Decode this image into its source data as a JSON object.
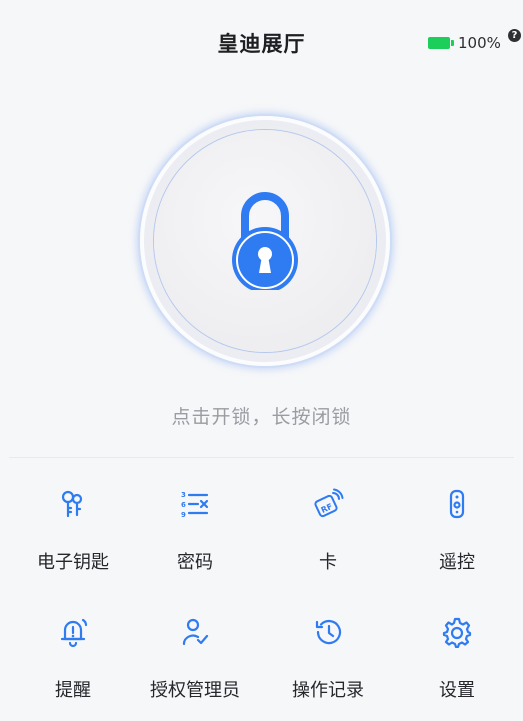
{
  "header": {
    "title": "皇迪展厅",
    "battery_text": "100%",
    "help_glyph": "?"
  },
  "lock": {
    "state_icon": "lock-icon",
    "hint": "点击开锁，长按闭锁"
  },
  "menu": {
    "items": [
      {
        "label": "电子钥匙",
        "icon": "keys-icon"
      },
      {
        "label": "密码",
        "icon": "password-list-icon"
      },
      {
        "label": "卡",
        "icon": "rf-card-icon"
      },
      {
        "label": "遥控",
        "icon": "remote-control-icon"
      },
      {
        "label": "提醒",
        "icon": "bell-icon"
      },
      {
        "label": "授权管理员",
        "icon": "user-check-icon"
      },
      {
        "label": "操作记录",
        "icon": "history-icon"
      },
      {
        "label": "设置",
        "icon": "gear-icon"
      }
    ]
  },
  "colors": {
    "accent": "#2f7bf2",
    "battery": "#1bcf5a",
    "text": "#26272b",
    "hint": "#9b9ca1",
    "background": "#f6f7f9"
  }
}
